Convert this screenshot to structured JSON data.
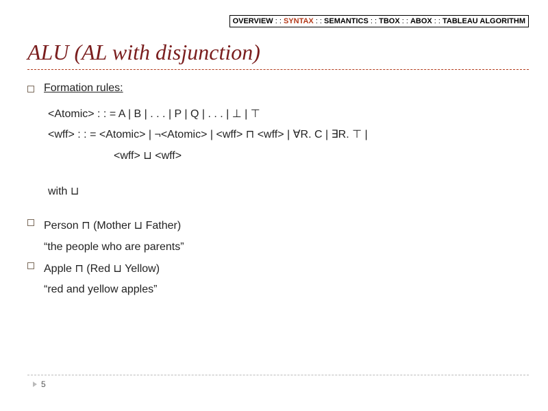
{
  "breadcrumb": {
    "items": [
      "OVERVIEW",
      "SYNTAX",
      "SEMANTICS",
      "TBOX",
      "ABOX",
      "TABLEAU ALGORITHM"
    ],
    "sep": " : : ",
    "active_index": 1
  },
  "title": "ALU (AL with disjunction)",
  "formation": {
    "label": "Formation rules:",
    "atomic": "<Atomic> : : = A | B | . . . | P | Q | . . . | ⊥ | ⊤",
    "wff1": "<wff> : : = <Atomic> | ¬<Atomic> | <wff> ⊓ <wff> | ∀R. C | ∃R. ⊤ |",
    "wff2": "<wff> ⊔ <wff>"
  },
  "with": "with ⊔",
  "examples": [
    {
      "expr": "Person ⊓ (Mother ⊔ Father)",
      "gloss": "“the people who are parents”"
    },
    {
      "expr": "Apple ⊓ (Red ⊔ Yellow)",
      "gloss": "“red and yellow apples”"
    }
  ],
  "page": "5"
}
